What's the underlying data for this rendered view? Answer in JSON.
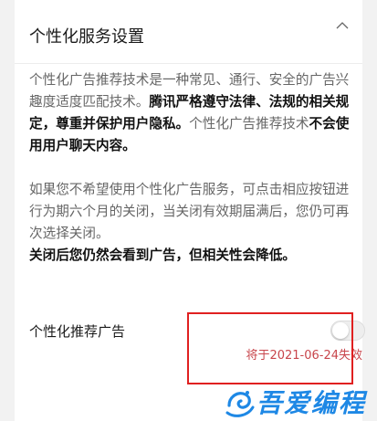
{
  "panel": {
    "title": "个性化服务设置",
    "collapse_icon": "chevron-up-icon"
  },
  "description": {
    "p1_normal": "个性化广告推荐技术是一种常见、通行、安全的广告兴趣度适度匹配技术。",
    "p1_bold_1": "腾讯严格遵守法律、法规的相关规定，尊重并保护用户隐私。",
    "p1_normal_2": "个性化广告推荐技术",
    "p1_bold_2": "不会使用用户聊天内容。",
    "p2_normal": "如果您不希望使用个性化广告服务，可点击相应按钮进行为期六个月的关闭，当关闭有效期届满后，您仍可再次选择关闭。",
    "p3_bold": "关闭后您仍然会看到广告，但相关性会降低。"
  },
  "setting": {
    "label": "个性化推荐广告",
    "toggle_on": false,
    "expiry_text": "将于2021-06-24失效"
  },
  "watermark": {
    "text": "吾爱编程",
    "logo_icon": "swirl-logo-icon"
  },
  "colors": {
    "highlight": "#e02020",
    "expiry": "#c8454b",
    "watermark": "#1e88e5"
  }
}
